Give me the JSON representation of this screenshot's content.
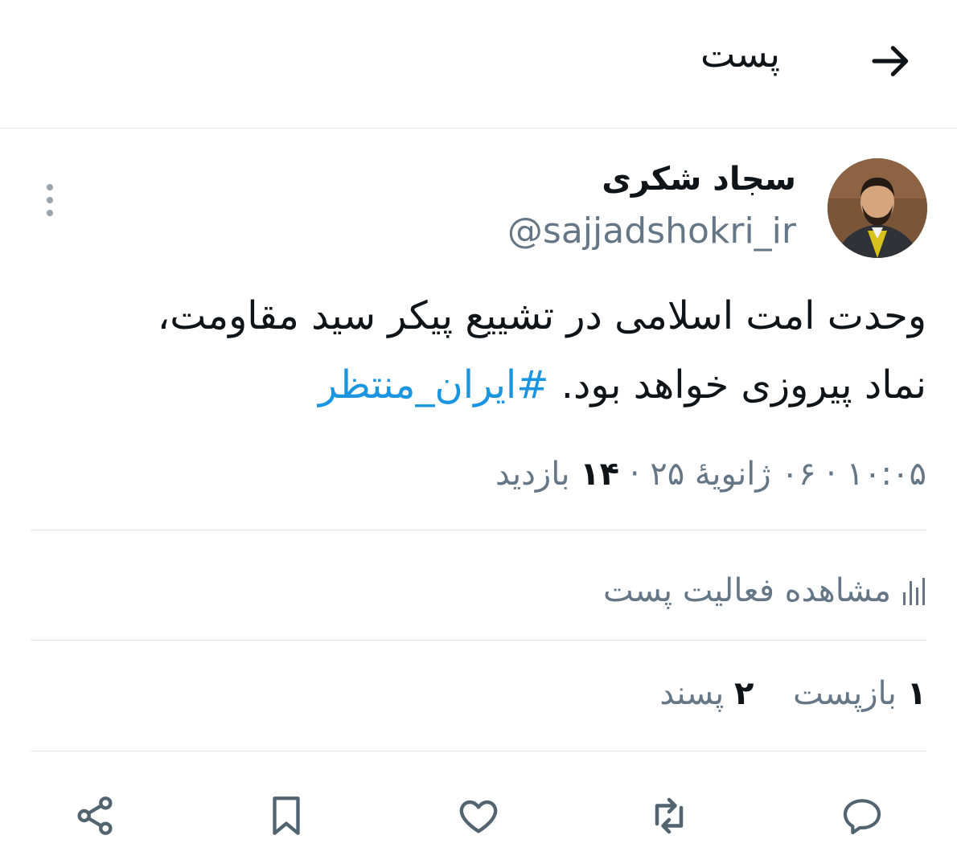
{
  "header": {
    "title": "پست",
    "back_icon": "arrow-right-icon"
  },
  "author": {
    "display_name": "سجاد شکری",
    "handle": "@sajjadshokri_ir"
  },
  "tweet": {
    "text_line1": "وحدت امت اسلامی در تشییع پیکر سید مقاومت،",
    "text_line2": "نماد پیروزی خواهد بود.",
    "hashtag": "#ایران_منتظر"
  },
  "meta": {
    "time": "۱۰:۰۵",
    "date": "۰۶ ژانویهٔ ۲۵",
    "views_count": "۱۴",
    "views_label": "بازدید",
    "separator": "·"
  },
  "activity": {
    "label": "مشاهده فعالیت پست",
    "icon": "bar-chart-icon"
  },
  "stats": {
    "reposts_count": "۱",
    "reposts_label": "بازپست",
    "likes_count": "۲",
    "likes_label": "پسند"
  },
  "actions": {
    "icons": [
      "reply-icon",
      "repost-icon",
      "like-icon",
      "bookmark-icon",
      "share-icon"
    ]
  },
  "colors": {
    "accent": "#1b95e0",
    "secondary_text": "#657786",
    "divider": "#e3e6e9",
    "icon": "#536471"
  }
}
